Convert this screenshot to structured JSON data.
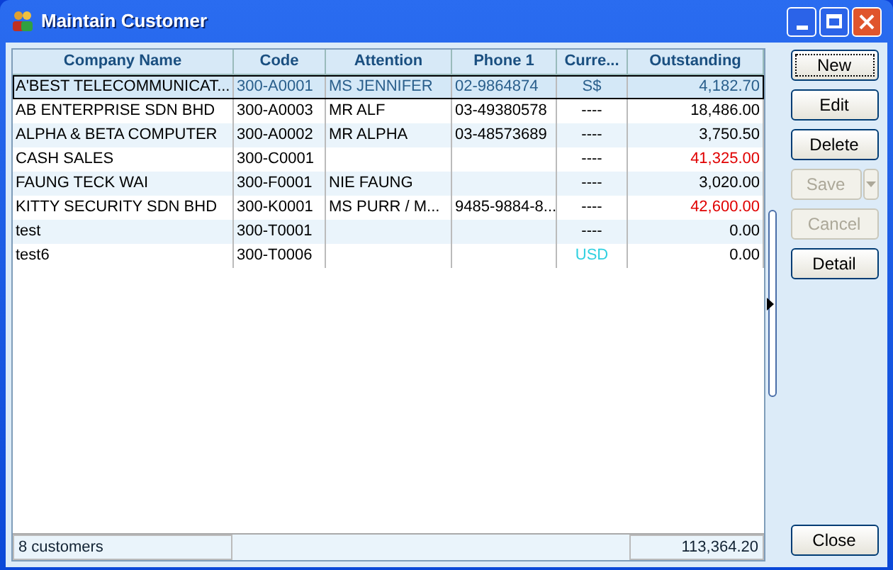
{
  "window": {
    "title": "Maintain Customer"
  },
  "table": {
    "columns": [
      "Company Name",
      "Code",
      "Attention",
      "Phone 1",
      "Curre...",
      "Outstanding"
    ],
    "rows": [
      {
        "selected": true,
        "overdue": false,
        "currency_highlighted": false,
        "cells": [
          "A'BEST TELECOMMUNICAT...",
          "300-A0001",
          "MS JENNIFER",
          "02-9864874",
          "S$",
          "4,182.70"
        ]
      },
      {
        "selected": false,
        "overdue": false,
        "currency_highlighted": false,
        "cells": [
          "AB ENTERPRISE SDN BHD",
          "300-A0003",
          "MR ALF",
          "03-49380578",
          "----",
          "18,486.00"
        ]
      },
      {
        "selected": false,
        "overdue": false,
        "currency_highlighted": false,
        "cells": [
          "ALPHA & BETA COMPUTER",
          "300-A0002",
          "MR ALPHA",
          "03-48573689",
          "----",
          "3,750.50"
        ]
      },
      {
        "selected": false,
        "overdue": true,
        "currency_highlighted": false,
        "cells": [
          "CASH SALES",
          "300-C0001",
          "",
          "",
          "----",
          "41,325.00"
        ]
      },
      {
        "selected": false,
        "overdue": false,
        "currency_highlighted": false,
        "cells": [
          "FAUNG TECK WAI",
          "300-F0001",
          "NIE FAUNG",
          "",
          "----",
          "3,020.00"
        ]
      },
      {
        "selected": false,
        "overdue": true,
        "currency_highlighted": false,
        "cells": [
          "KITTY SECURITY SDN BHD",
          "300-K0001",
          "MS PURR / M...",
          "9485-9884-8...",
          "----",
          "42,600.00"
        ]
      },
      {
        "selected": false,
        "overdue": false,
        "currency_highlighted": false,
        "cells": [
          "test",
          "300-T0001",
          "",
          "",
          "----",
          "0.00"
        ]
      },
      {
        "selected": false,
        "overdue": false,
        "currency_highlighted": true,
        "cells": [
          "test6",
          "300-T0006",
          "",
          "",
          "USD",
          "0.00"
        ]
      }
    ],
    "footer": {
      "count": "8 customers",
      "total": "113,364.20"
    }
  },
  "buttons": [
    {
      "label": "New",
      "disabled": false,
      "default": true
    },
    {
      "label": "Edit",
      "disabled": false,
      "default": false
    },
    {
      "label": "Delete",
      "disabled": false,
      "default": false
    },
    {
      "label": "Save",
      "disabled": true,
      "default": false,
      "kind": "split"
    },
    {
      "label": "Cancel",
      "disabled": true,
      "default": false
    },
    {
      "label": "Detail",
      "disabled": false,
      "default": false
    }
  ],
  "close_button": {
    "label": "Close"
  }
}
